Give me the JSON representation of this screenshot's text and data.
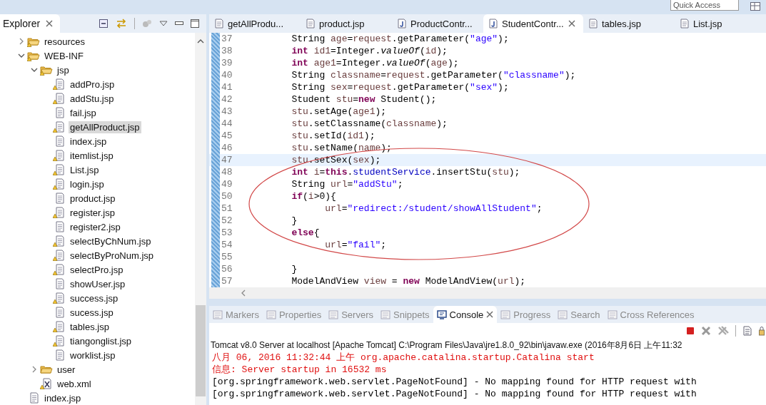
{
  "toolbar": {
    "quick_access": {
      "placeholder": "Quick Access"
    }
  },
  "explorer": {
    "title": "Explorer",
    "tree": [
      {
        "label": "resources",
        "kind": "folder",
        "expanded": false,
        "warning": true,
        "selected": false
      },
      {
        "label": "WEB-INF",
        "kind": "folder",
        "expanded": true,
        "warning": true,
        "selected": false,
        "children": [
          {
            "label": "jsp",
            "kind": "folder",
            "expanded": true,
            "warning": true,
            "selected": false,
            "children": [
              {
                "label": "addPro.jsp",
                "kind": "file",
                "warning": true,
                "selected": false
              },
              {
                "label": "addStu.jsp",
                "kind": "file",
                "warning": true,
                "selected": false
              },
              {
                "label": "fail.jsp",
                "kind": "file",
                "warning": false,
                "selected": false
              },
              {
                "label": "getAllProduct.jsp",
                "kind": "file",
                "warning": true,
                "selected": true
              },
              {
                "label": "index.jsp",
                "kind": "file",
                "warning": false,
                "selected": false
              },
              {
                "label": "itemlist.jsp",
                "kind": "file",
                "warning": true,
                "selected": false
              },
              {
                "label": "List.jsp",
                "kind": "file",
                "warning": true,
                "selected": false
              },
              {
                "label": "login.jsp",
                "kind": "file",
                "warning": true,
                "selected": false
              },
              {
                "label": "product.jsp",
                "kind": "file",
                "warning": false,
                "selected": false
              },
              {
                "label": "register.jsp",
                "kind": "file",
                "warning": true,
                "selected": false
              },
              {
                "label": "register2.jsp",
                "kind": "file",
                "warning": false,
                "selected": false
              },
              {
                "label": "selectByChNum.jsp",
                "kind": "file",
                "warning": true,
                "selected": false
              },
              {
                "label": "selectByProNum.jsp",
                "kind": "file",
                "warning": true,
                "selected": false
              },
              {
                "label": "selectPro.jsp",
                "kind": "file",
                "warning": true,
                "selected": false
              },
              {
                "label": "showUser.jsp",
                "kind": "file",
                "warning": false,
                "selected": false
              },
              {
                "label": "success.jsp",
                "kind": "file",
                "warning": true,
                "selected": false
              },
              {
                "label": "sucess.jsp",
                "kind": "file",
                "warning": false,
                "selected": false
              },
              {
                "label": "tables.jsp",
                "kind": "file",
                "warning": true,
                "selected": false
              },
              {
                "label": "tiangonglist.jsp",
                "kind": "file",
                "warning": true,
                "selected": false
              },
              {
                "label": "worklist.jsp",
                "kind": "file",
                "warning": false,
                "selected": false
              }
            ]
          },
          {
            "label": "user",
            "kind": "folder",
            "expanded": false,
            "warning": false,
            "selected": false
          },
          {
            "label": "web.xml",
            "kind": "xml",
            "warning": true,
            "selected": false
          }
        ]
      },
      {
        "label": "index.jsp",
        "kind": "file",
        "warning": false,
        "selected": false
      }
    ]
  },
  "editor": {
    "tabs": [
      {
        "label": "getAllProdu...",
        "kind": "jsp",
        "selected": false
      },
      {
        "label": "product.jsp",
        "kind": "jsp",
        "selected": false
      },
      {
        "label": "ProductContr...",
        "kind": "java",
        "selected": false
      },
      {
        "label": "StudentContr...",
        "kind": "java",
        "selected": true
      },
      {
        "label": "tables.jsp",
        "kind": "jsp",
        "selected": false
      },
      {
        "label": "List.jsp",
        "kind": "jsp",
        "selected": false
      }
    ],
    "lines": [
      {
        "number": "37",
        "current": false,
        "tokens": [
          {
            "t": "        String ",
            "kind": "plain"
          },
          {
            "t": "age",
            "kind": "local"
          },
          {
            "t": "=",
            "kind": "plain"
          },
          {
            "t": "request",
            "kind": "local"
          },
          {
            "t": ".getParameter(",
            "kind": "plain"
          },
          {
            "t": "\"age\"",
            "kind": "string"
          },
          {
            "t": ");",
            "kind": "plain"
          }
        ]
      },
      {
        "number": "38",
        "current": false,
        "tokens": [
          {
            "t": "        int",
            "kind": "keyword"
          },
          {
            "t": " id1",
            "kind": "local"
          },
          {
            "t": "=Integer.",
            "kind": "plain"
          },
          {
            "t": "valueOf",
            "kind": "static"
          },
          {
            "t": "(",
            "kind": "plain"
          },
          {
            "t": "id",
            "kind": "local"
          },
          {
            "t": ");",
            "kind": "plain"
          }
        ]
      },
      {
        "number": "39",
        "current": false,
        "tokens": [
          {
            "t": "        int",
            "kind": "keyword"
          },
          {
            "t": " age1",
            "kind": "local"
          },
          {
            "t": "=Integer.",
            "kind": "plain"
          },
          {
            "t": "valueOf",
            "kind": "static"
          },
          {
            "t": "(",
            "kind": "plain"
          },
          {
            "t": "age",
            "kind": "local"
          },
          {
            "t": ");",
            "kind": "plain"
          }
        ]
      },
      {
        "number": "40",
        "current": false,
        "tokens": [
          {
            "t": "        String ",
            "kind": "plain"
          },
          {
            "t": "classname",
            "kind": "local"
          },
          {
            "t": "=",
            "kind": "plain"
          },
          {
            "t": "request",
            "kind": "local"
          },
          {
            "t": ".getParameter(",
            "kind": "plain"
          },
          {
            "t": "\"classname\"",
            "kind": "string"
          },
          {
            "t": ");",
            "kind": "plain"
          }
        ]
      },
      {
        "number": "41",
        "current": false,
        "tokens": [
          {
            "t": "        String ",
            "kind": "plain"
          },
          {
            "t": "sex",
            "kind": "local"
          },
          {
            "t": "=",
            "kind": "plain"
          },
          {
            "t": "request",
            "kind": "local"
          },
          {
            "t": ".getParameter(",
            "kind": "plain"
          },
          {
            "t": "\"sex\"",
            "kind": "string"
          },
          {
            "t": ");",
            "kind": "plain"
          }
        ]
      },
      {
        "number": "42",
        "current": false,
        "tokens": [
          {
            "t": "        Student ",
            "kind": "plain"
          },
          {
            "t": "stu",
            "kind": "local"
          },
          {
            "t": "=",
            "kind": "plain"
          },
          {
            "t": "new",
            "kind": "keyword"
          },
          {
            "t": " Student();",
            "kind": "plain"
          }
        ]
      },
      {
        "number": "43",
        "current": false,
        "tokens": [
          {
            "t": "        stu",
            "kind": "local"
          },
          {
            "t": ".setAge(",
            "kind": "plain"
          },
          {
            "t": "age1",
            "kind": "local"
          },
          {
            "t": ");",
            "kind": "plain"
          }
        ]
      },
      {
        "number": "44",
        "current": false,
        "tokens": [
          {
            "t": "        stu",
            "kind": "local"
          },
          {
            "t": ".setClassname(",
            "kind": "plain"
          },
          {
            "t": "classname",
            "kind": "local"
          },
          {
            "t": ");",
            "kind": "plain"
          }
        ]
      },
      {
        "number": "45",
        "current": false,
        "tokens": [
          {
            "t": "        stu",
            "kind": "local"
          },
          {
            "t": ".setId(",
            "kind": "plain"
          },
          {
            "t": "id1",
            "kind": "local"
          },
          {
            "t": ");",
            "kind": "plain"
          }
        ]
      },
      {
        "number": "46",
        "current": false,
        "tokens": [
          {
            "t": "        stu",
            "kind": "local"
          },
          {
            "t": ".setName(",
            "kind": "plain"
          },
          {
            "t": "name",
            "kind": "local"
          },
          {
            "t": ");",
            "kind": "plain"
          }
        ]
      },
      {
        "number": "47",
        "current": true,
        "tokens": [
          {
            "t": "        stu",
            "kind": "local"
          },
          {
            "t": ".setSex(",
            "kind": "plain"
          },
          {
            "t": "sex",
            "kind": "local"
          },
          {
            "t": ");",
            "kind": "plain"
          }
        ]
      },
      {
        "number": "48",
        "current": false,
        "tokens": [
          {
            "t": "        int",
            "kind": "keyword"
          },
          {
            "t": " i",
            "kind": "local"
          },
          {
            "t": "=",
            "kind": "plain"
          },
          {
            "t": "this",
            "kind": "keyword"
          },
          {
            "t": ".",
            "kind": "plain"
          },
          {
            "t": "studentService",
            "kind": "field"
          },
          {
            "t": ".insertStu(",
            "kind": "plain"
          },
          {
            "t": "stu",
            "kind": "local"
          },
          {
            "t": ");",
            "kind": "plain"
          }
        ]
      },
      {
        "number": "49",
        "current": false,
        "tokens": [
          {
            "t": "        String ",
            "kind": "plain"
          },
          {
            "t": "url",
            "kind": "local"
          },
          {
            "t": "=",
            "kind": "plain"
          },
          {
            "t": "\"addStu\"",
            "kind": "string"
          },
          {
            "t": ";",
            "kind": "plain"
          }
        ]
      },
      {
        "number": "50",
        "current": false,
        "tokens": [
          {
            "t": "        if",
            "kind": "keyword"
          },
          {
            "t": "(",
            "kind": "plain"
          },
          {
            "t": "i",
            "kind": "local"
          },
          {
            "t": ">0){",
            "kind": "plain"
          }
        ]
      },
      {
        "number": "51",
        "current": false,
        "tokens": [
          {
            "t": "              url",
            "kind": "local"
          },
          {
            "t": "=",
            "kind": "plain"
          },
          {
            "t": "\"redirect:/student/showAllStudent\"",
            "kind": "string"
          },
          {
            "t": ";",
            "kind": "plain"
          }
        ]
      },
      {
        "number": "52",
        "current": false,
        "tokens": [
          {
            "t": "        }",
            "kind": "plain"
          }
        ]
      },
      {
        "number": "53",
        "current": false,
        "tokens": [
          {
            "t": "        else",
            "kind": "keyword"
          },
          {
            "t": "{",
            "kind": "plain"
          }
        ]
      },
      {
        "number": "54",
        "current": false,
        "tokens": [
          {
            "t": "              url",
            "kind": "local"
          },
          {
            "t": "=",
            "kind": "plain"
          },
          {
            "t": "\"fail\"",
            "kind": "string"
          },
          {
            "t": ";",
            "kind": "plain"
          }
        ]
      },
      {
        "number": "55",
        "current": false
      },
      {
        "number": "56",
        "current": false,
        "tokens": [
          {
            "t": "        }",
            "kind": "plain"
          }
        ]
      },
      {
        "number": "57",
        "current": false,
        "tokens": [
          {
            "t": "        ModelAndView ",
            "kind": "plain"
          },
          {
            "t": "view",
            "kind": "local"
          },
          {
            "t": " = ",
            "kind": "plain"
          },
          {
            "t": "new",
            "kind": "keyword"
          },
          {
            "t": " ModelAndView(",
            "kind": "plain"
          },
          {
            "t": "url",
            "kind": "local"
          },
          {
            "t": ");",
            "kind": "plain"
          }
        ]
      }
    ]
  },
  "console_view": {
    "tabs": [
      {
        "label": "Markers",
        "selected": false
      },
      {
        "label": "Properties",
        "selected": false
      },
      {
        "label": "Servers",
        "selected": false
      },
      {
        "label": "Snippets",
        "selected": false
      },
      {
        "label": "Console",
        "selected": true
      },
      {
        "label": "Progress",
        "selected": false
      },
      {
        "label": "Search",
        "selected": false
      },
      {
        "label": "Cross References",
        "selected": false
      }
    ],
    "title": "Tomcat v8.0 Server at localhost [Apache Tomcat] C:\\Program Files\\Java\\jre1.8.0_92\\bin\\javaw.exe (2016年8月6日 上午11:32",
    "lines": [
      {
        "text": "八月 06, 2016 11:32:44 上午 org.apache.catalina.startup.Catalina start",
        "kind": "error"
      },
      {
        "text": "信息: Server startup in 16532 ms",
        "kind": "error"
      },
      {
        "text": "[org.springframework.web.servlet.PageNotFound] - No mapping found for HTTP request with",
        "kind": "output"
      },
      {
        "text": "[org.springframework.web.servlet.PageNotFound] - No mapping found for HTTP request with",
        "kind": "output"
      }
    ]
  }
}
